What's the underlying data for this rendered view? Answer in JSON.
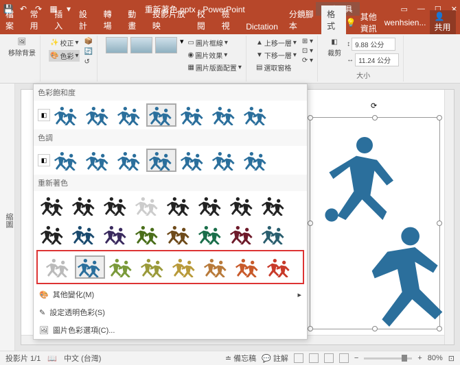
{
  "titlebar": {
    "title": "重新著色.pptx - PowerPoint",
    "contextual_tab": "圖片工具"
  },
  "tabs": {
    "file": "檔案",
    "home": "常用",
    "insert": "插入",
    "design": "設計",
    "transition": "轉場",
    "anim": "動畫",
    "slideshow": "投影片放映",
    "review": "校閱",
    "view": "檢視",
    "dictation": "Dictation",
    "bunkyo": "分鏡腳本",
    "format": "格式",
    "other_info": "其他資訊",
    "user": "wenhsien...",
    "share": "共用"
  },
  "ribbon": {
    "remove_bg": "移除背景",
    "corrections": "校正",
    "color": "色彩",
    "border": "圖片框線",
    "effects": "圖片效果",
    "layout": "圖片版面配置",
    "forward": "上移一層",
    "backward": "下移一層",
    "selection": "選取窗格",
    "crop": "裁剪",
    "size_label": "大小",
    "width": "9.88 公分",
    "height": "11.24 公分"
  },
  "dropdown": {
    "saturation": "色彩飽和度",
    "tone": "色調",
    "recolor": "重新著色",
    "more_variations": "其他變化(M)",
    "set_transparent": "設定透明色彩(S)",
    "picture_options": "圖片色彩選項(C)..."
  },
  "swatch_colors": {
    "row1": [
      "#2b6f9c",
      "#2b6f9c",
      "#2b6f9c",
      "#2b6f9c",
      "#2b6f9c",
      "#2b6f9c",
      "#2b6f9c"
    ],
    "row2": [
      "#2b6f9c",
      "#2b6f9c",
      "#2b6f9c",
      "#2b6f9c",
      "#2b6f9c",
      "#2b6f9c",
      "#2b6f9c"
    ],
    "row3": [
      "#222",
      "#222",
      "#222",
      "#ccc",
      "#222",
      "#222",
      "#222",
      "#222"
    ],
    "row4": [
      "#222",
      "#1a4a6e",
      "#3a2a5e",
      "#4a6e1a",
      "#6e4a1a",
      "#1a6e4a",
      "#6e1a2a",
      "#2a5e6e"
    ],
    "row5": [
      "#bbb",
      "#2b6f9c",
      "#7a9a3a",
      "#9a9a3a",
      "#b89a3a",
      "#b87a3a",
      "#c85a2a",
      "#c83a2a"
    ]
  },
  "sidepanel": "縮圖",
  "status": {
    "slide": "投影片 1/1",
    "lang": "中文 (台灣)",
    "notes": "備忘稿",
    "comments": "註解",
    "zoom": "80%"
  }
}
